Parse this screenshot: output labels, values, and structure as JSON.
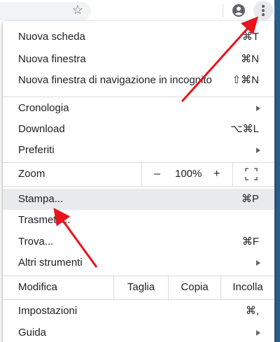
{
  "toolbar": {
    "icons": [
      "star-icon",
      "account-icon",
      "more-vert-icon"
    ]
  },
  "menu": {
    "group1": [
      {
        "label": "Nuova scheda",
        "shortcut": "⌘T"
      },
      {
        "label": "Nuova finestra",
        "shortcut": "⌘N"
      },
      {
        "label": "Nuova finestra di navigazione in incognito",
        "shortcut": "⇧⌘N"
      }
    ],
    "group2": [
      {
        "label": "Cronologia",
        "shortcut": ""
      },
      {
        "label": "Download",
        "shortcut": "⌥⌘L"
      },
      {
        "label": "Preferiti",
        "shortcut": ""
      }
    ],
    "zoom": {
      "label": "Zoom",
      "minus": "–",
      "value": "100%",
      "plus": "+"
    },
    "group3": [
      {
        "label": "Stampa...",
        "shortcut": "⌘P"
      },
      {
        "label": "Trasmetti...",
        "shortcut": ""
      },
      {
        "label": "Trova...",
        "shortcut": "⌘F"
      },
      {
        "label": "Altri strumenti",
        "shortcut": ""
      }
    ],
    "edit": {
      "label": "Modifica",
      "cut": "Taglia",
      "copy": "Copia",
      "paste": "Incolla"
    },
    "group4": [
      {
        "label": "Impostazioni",
        "shortcut": "⌘,"
      },
      {
        "label": "Guida",
        "shortcut": ""
      }
    ]
  },
  "colors": {
    "annotation_arrow": "#e8131b",
    "highlight": "#e8eaed",
    "separator": "#dadce0"
  }
}
